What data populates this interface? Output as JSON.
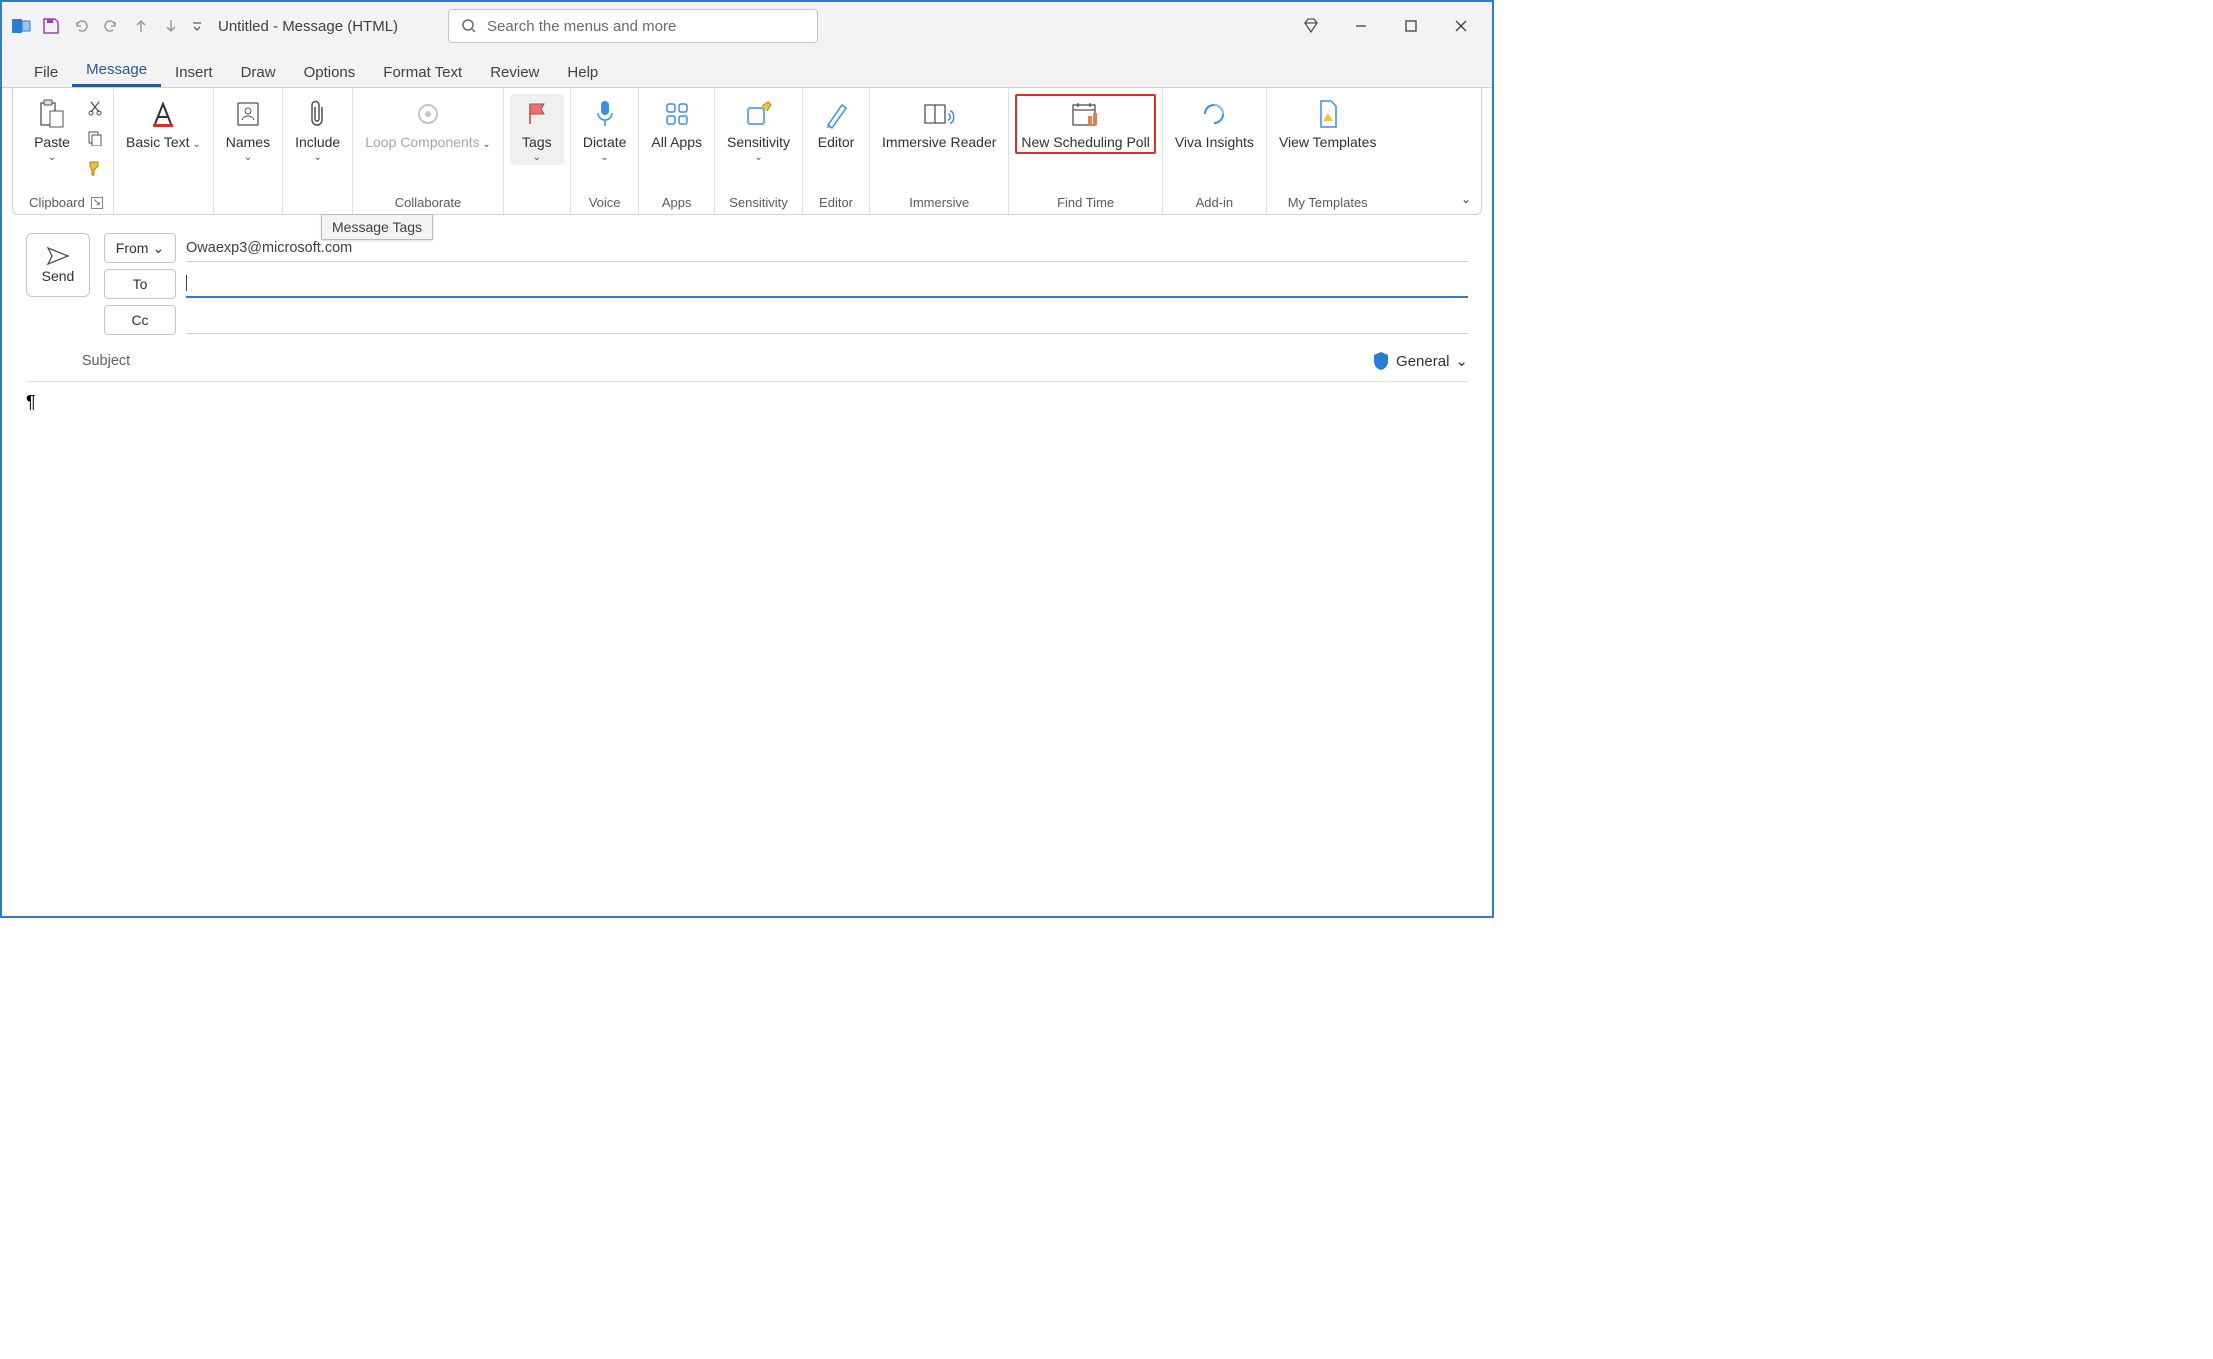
{
  "title": "Untitled  -  Message (HTML)",
  "search_placeholder": "Search the menus and more",
  "tabs": [
    "File",
    "Message",
    "Insert",
    "Draw",
    "Options",
    "Format Text",
    "Review",
    "Help"
  ],
  "active_tab": "Message",
  "ribbon": {
    "clipboard": {
      "paste": "Paste",
      "label": "Clipboard"
    },
    "basic_text": {
      "label": "Basic Text"
    },
    "names": {
      "label": "Names"
    },
    "include": {
      "label": "Include"
    },
    "loop": {
      "label": "Loop Components",
      "group": "Collaborate"
    },
    "tags": {
      "label": "Tags"
    },
    "dictate": {
      "label": "Dictate",
      "group": "Voice"
    },
    "apps": {
      "label": "All Apps",
      "group": "Apps"
    },
    "sensitivity": {
      "label": "Sensitivity",
      "group": "Sensitivity"
    },
    "editor": {
      "label": "Editor",
      "group": "Editor"
    },
    "immersive": {
      "label": "Immersive Reader",
      "group": "Immersive"
    },
    "scheduling": {
      "label": "New Scheduling Poll",
      "group": "Find Time"
    },
    "viva": {
      "label": "Viva Insights",
      "group": "Add-in"
    },
    "templates": {
      "label": "View Templates",
      "group": "My Templates"
    }
  },
  "tooltip": "Message Tags",
  "compose": {
    "send": "Send",
    "from": "From",
    "from_value": "Owaexp3@microsoft.com",
    "to": "To",
    "cc": "Cc",
    "subject": "Subject",
    "sensitivity": "General"
  },
  "body": "¶"
}
